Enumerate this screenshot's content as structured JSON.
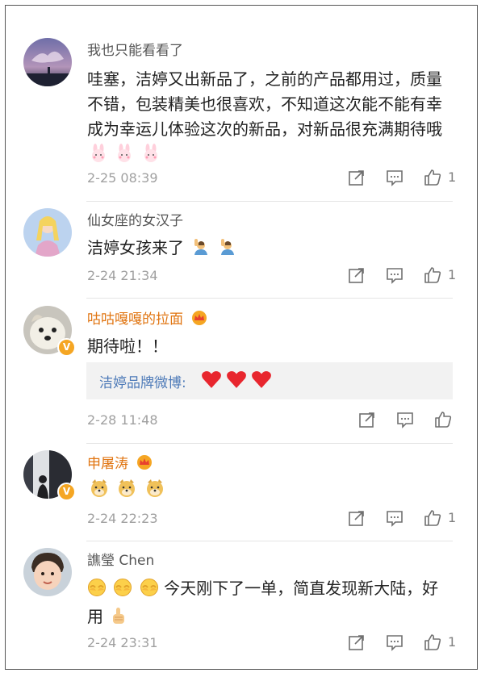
{
  "comments": [
    {
      "username": "我也只能看看了",
      "username_color": "#555555",
      "text": "哇塞，洁婷又出新品了，之前的产品都用过，质量不错，包装精美也很喜欢，不知道这次能不能有幸成为幸运儿体验这次的新品，对新品很充满期待哦",
      "emojis": [
        "bunny-emoji",
        "bunny-emoji",
        "bunny-emoji"
      ],
      "time": "2-25 08:39",
      "like_count": "1"
    },
    {
      "username": "仙女座的女汉子",
      "username_color": "#555555",
      "text": "洁婷女孩来了",
      "emojis": [
        "raising-hand-emoji",
        "raising-hand-emoji"
      ],
      "time": "2-24 21:34",
      "like_count": "1"
    },
    {
      "username": "咕咕嘎嘎的拉面",
      "username_color": "#e07410",
      "verified": true,
      "text": "期待啦！！",
      "reply": {
        "name": "洁婷品牌微博:",
        "emojis": [
          "red-heart-emoji",
          "red-heart-emoji",
          "red-heart-emoji"
        ]
      },
      "time": "2-28 11:48",
      "like_count": ""
    },
    {
      "username": "申屠涛",
      "username_color": "#e07410",
      "verified": true,
      "text": "",
      "emojis": [
        "doge-emoji",
        "doge-emoji",
        "doge-emoji"
      ],
      "time": "2-24 22:23",
      "like_count": "1"
    },
    {
      "username": "譙瑩 Chen",
      "username_color": "#555555",
      "text": "今天刚下了一单，简直发现新大陆，好用",
      "emojis": [
        "hiding-face-emoji",
        "hiding-face-emoji",
        "hiding-face-emoji"
      ],
      "trailing_emoji": "thumbs-up-emoji",
      "time": "2-24 23:31",
      "like_count": "1"
    }
  ]
}
